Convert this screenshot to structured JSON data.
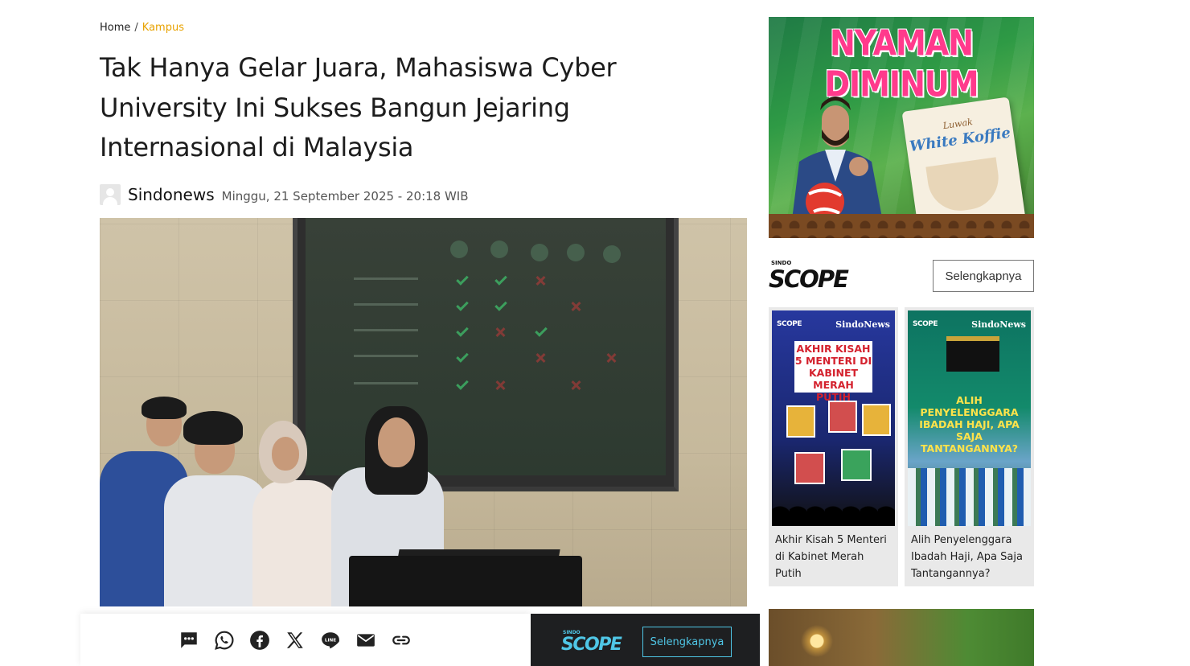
{
  "breadcrumb": {
    "home": "Home",
    "separator": "/",
    "current": "Kampus"
  },
  "article": {
    "title": "Tak Hanya Gelar Juara, Mahasiswa Cyber University Ini Sukses Bangun Jejaring Internasional di Malaysia",
    "author": "Sindonews",
    "date": "Minggu, 21 September 2025 - 20:18 WIB"
  },
  "share_icons": [
    "comment-icon",
    "whatsapp-icon",
    "facebook-icon",
    "x-icon",
    "line-icon",
    "email-icon",
    "link-icon"
  ],
  "share_strip": {
    "logo_small": "SINDO",
    "logo_big": "SCOPE",
    "button": "Selengkapnya"
  },
  "ad_top": {
    "headline": "NYAMAN DIMINUM",
    "brand": "Luwak",
    "product": "White Koffie"
  },
  "scope_section": {
    "logo_small": "SINDO",
    "logo_big": "SCOPE",
    "more_button": "Selengkapnya",
    "cards": [
      {
        "badge": "SCOPE",
        "source": "SindoNews",
        "thumb_title": "AKHIR KISAH 5 MENTERI DI KABINET MERAH PUTIH",
        "caption": "Akhir Kisah 5 Menteri di Kabinet Merah Putih"
      },
      {
        "badge": "SCOPE",
        "source": "SindoNews",
        "thumb_title": "ALIH PENYELENGGARA IBADAH HAJI, APA SAJA TANTANGANNYA?",
        "caption": "Alih Penyelenggara Ibadah Haji, Apa Saja Tantangannya?"
      }
    ]
  },
  "colors": {
    "accent": "#e8a200",
    "scope_blue": "#4fc6e6",
    "ad_pink": "#ff3a8c",
    "card1_bg": "#1d2a8a",
    "card2_bg": "#0b6b5a"
  }
}
